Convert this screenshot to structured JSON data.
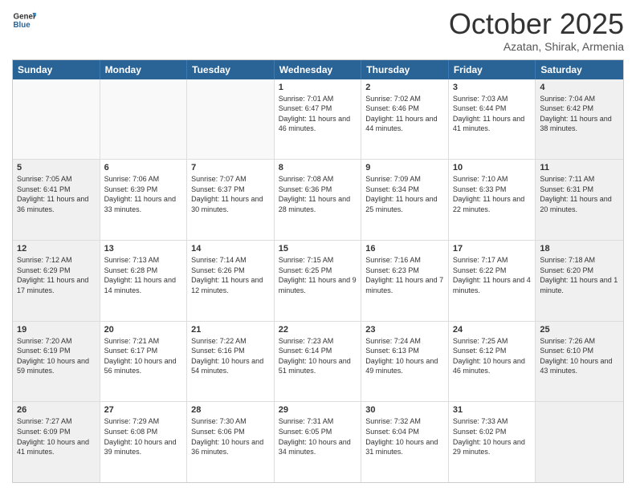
{
  "header": {
    "logo_general": "General",
    "logo_blue": "Blue",
    "month": "October 2025",
    "location": "Azatan, Shirak, Armenia"
  },
  "days_of_week": [
    "Sunday",
    "Monday",
    "Tuesday",
    "Wednesday",
    "Thursday",
    "Friday",
    "Saturday"
  ],
  "rows": [
    [
      {
        "day": "",
        "info": "",
        "shaded": false,
        "empty": true
      },
      {
        "day": "",
        "info": "",
        "shaded": false,
        "empty": true
      },
      {
        "day": "",
        "info": "",
        "shaded": false,
        "empty": true
      },
      {
        "day": "1",
        "info": "Sunrise: 7:01 AM\nSunset: 6:47 PM\nDaylight: 11 hours\nand 46 minutes.",
        "shaded": false,
        "empty": false
      },
      {
        "day": "2",
        "info": "Sunrise: 7:02 AM\nSunset: 6:46 PM\nDaylight: 11 hours\nand 44 minutes.",
        "shaded": false,
        "empty": false
      },
      {
        "day": "3",
        "info": "Sunrise: 7:03 AM\nSunset: 6:44 PM\nDaylight: 11 hours\nand 41 minutes.",
        "shaded": false,
        "empty": false
      },
      {
        "day": "4",
        "info": "Sunrise: 7:04 AM\nSunset: 6:42 PM\nDaylight: 11 hours\nand 38 minutes.",
        "shaded": true,
        "empty": false
      }
    ],
    [
      {
        "day": "5",
        "info": "Sunrise: 7:05 AM\nSunset: 6:41 PM\nDaylight: 11 hours\nand 36 minutes.",
        "shaded": true,
        "empty": false
      },
      {
        "day": "6",
        "info": "Sunrise: 7:06 AM\nSunset: 6:39 PM\nDaylight: 11 hours\nand 33 minutes.",
        "shaded": false,
        "empty": false
      },
      {
        "day": "7",
        "info": "Sunrise: 7:07 AM\nSunset: 6:37 PM\nDaylight: 11 hours\nand 30 minutes.",
        "shaded": false,
        "empty": false
      },
      {
        "day": "8",
        "info": "Sunrise: 7:08 AM\nSunset: 6:36 PM\nDaylight: 11 hours\nand 28 minutes.",
        "shaded": false,
        "empty": false
      },
      {
        "day": "9",
        "info": "Sunrise: 7:09 AM\nSunset: 6:34 PM\nDaylight: 11 hours\nand 25 minutes.",
        "shaded": false,
        "empty": false
      },
      {
        "day": "10",
        "info": "Sunrise: 7:10 AM\nSunset: 6:33 PM\nDaylight: 11 hours\nand 22 minutes.",
        "shaded": false,
        "empty": false
      },
      {
        "day": "11",
        "info": "Sunrise: 7:11 AM\nSunset: 6:31 PM\nDaylight: 11 hours\nand 20 minutes.",
        "shaded": true,
        "empty": false
      }
    ],
    [
      {
        "day": "12",
        "info": "Sunrise: 7:12 AM\nSunset: 6:29 PM\nDaylight: 11 hours\nand 17 minutes.",
        "shaded": true,
        "empty": false
      },
      {
        "day": "13",
        "info": "Sunrise: 7:13 AM\nSunset: 6:28 PM\nDaylight: 11 hours\nand 14 minutes.",
        "shaded": false,
        "empty": false
      },
      {
        "day": "14",
        "info": "Sunrise: 7:14 AM\nSunset: 6:26 PM\nDaylight: 11 hours\nand 12 minutes.",
        "shaded": false,
        "empty": false
      },
      {
        "day": "15",
        "info": "Sunrise: 7:15 AM\nSunset: 6:25 PM\nDaylight: 11 hours\nand 9 minutes.",
        "shaded": false,
        "empty": false
      },
      {
        "day": "16",
        "info": "Sunrise: 7:16 AM\nSunset: 6:23 PM\nDaylight: 11 hours\nand 7 minutes.",
        "shaded": false,
        "empty": false
      },
      {
        "day": "17",
        "info": "Sunrise: 7:17 AM\nSunset: 6:22 PM\nDaylight: 11 hours\nand 4 minutes.",
        "shaded": false,
        "empty": false
      },
      {
        "day": "18",
        "info": "Sunrise: 7:18 AM\nSunset: 6:20 PM\nDaylight: 11 hours\nand 1 minute.",
        "shaded": true,
        "empty": false
      }
    ],
    [
      {
        "day": "19",
        "info": "Sunrise: 7:20 AM\nSunset: 6:19 PM\nDaylight: 10 hours\nand 59 minutes.",
        "shaded": true,
        "empty": false
      },
      {
        "day": "20",
        "info": "Sunrise: 7:21 AM\nSunset: 6:17 PM\nDaylight: 10 hours\nand 56 minutes.",
        "shaded": false,
        "empty": false
      },
      {
        "day": "21",
        "info": "Sunrise: 7:22 AM\nSunset: 6:16 PM\nDaylight: 10 hours\nand 54 minutes.",
        "shaded": false,
        "empty": false
      },
      {
        "day": "22",
        "info": "Sunrise: 7:23 AM\nSunset: 6:14 PM\nDaylight: 10 hours\nand 51 minutes.",
        "shaded": false,
        "empty": false
      },
      {
        "day": "23",
        "info": "Sunrise: 7:24 AM\nSunset: 6:13 PM\nDaylight: 10 hours\nand 49 minutes.",
        "shaded": false,
        "empty": false
      },
      {
        "day": "24",
        "info": "Sunrise: 7:25 AM\nSunset: 6:12 PM\nDaylight: 10 hours\nand 46 minutes.",
        "shaded": false,
        "empty": false
      },
      {
        "day": "25",
        "info": "Sunrise: 7:26 AM\nSunset: 6:10 PM\nDaylight: 10 hours\nand 43 minutes.",
        "shaded": true,
        "empty": false
      }
    ],
    [
      {
        "day": "26",
        "info": "Sunrise: 7:27 AM\nSunset: 6:09 PM\nDaylight: 10 hours\nand 41 minutes.",
        "shaded": true,
        "empty": false
      },
      {
        "day": "27",
        "info": "Sunrise: 7:29 AM\nSunset: 6:08 PM\nDaylight: 10 hours\nand 39 minutes.",
        "shaded": false,
        "empty": false
      },
      {
        "day": "28",
        "info": "Sunrise: 7:30 AM\nSunset: 6:06 PM\nDaylight: 10 hours\nand 36 minutes.",
        "shaded": false,
        "empty": false
      },
      {
        "day": "29",
        "info": "Sunrise: 7:31 AM\nSunset: 6:05 PM\nDaylight: 10 hours\nand 34 minutes.",
        "shaded": false,
        "empty": false
      },
      {
        "day": "30",
        "info": "Sunrise: 7:32 AM\nSunset: 6:04 PM\nDaylight: 10 hours\nand 31 minutes.",
        "shaded": false,
        "empty": false
      },
      {
        "day": "31",
        "info": "Sunrise: 7:33 AM\nSunset: 6:02 PM\nDaylight: 10 hours\nand 29 minutes.",
        "shaded": false,
        "empty": false
      },
      {
        "day": "",
        "info": "",
        "shaded": true,
        "empty": true
      }
    ]
  ]
}
